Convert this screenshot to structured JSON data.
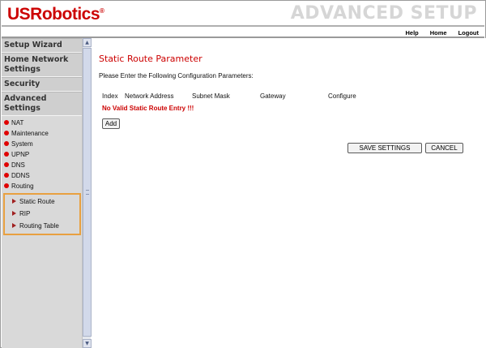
{
  "header": {
    "logo": "USRobotics",
    "logo_mark": "®",
    "title": "ADVANCED SETUP",
    "links": {
      "help": "Help",
      "home": "Home",
      "logout": "Logout"
    }
  },
  "sidebar": {
    "sections": [
      "Setup Wizard",
      "Home Network Settings",
      "Security",
      "Advanced Settings"
    ],
    "items": [
      "NAT",
      "Maintenance",
      "System",
      "UPNP",
      "DNS",
      "DDNS",
      "Routing"
    ],
    "routing_items": [
      "Static Route",
      "RIP",
      "Routing Table"
    ]
  },
  "main": {
    "title": "Static Route Parameter",
    "intro": "Please Enter the Following Configuration Parameters:",
    "columns": [
      "Index",
      "Network Address",
      "Subnet Mask",
      "Gateway",
      "Configure"
    ],
    "empty_message": "No Valid Static Route Entry !!!",
    "add_label": "Add",
    "save_label": "SAVE SETTINGS",
    "cancel_label": "CANCEL"
  },
  "icons": {
    "bullet": "red-dot-icon",
    "sub_bullet": "red-triangle-icon",
    "scroll_up": "chevron-up-icon",
    "scroll_down": "chevron-down-icon"
  },
  "colors": {
    "brand_red": "#cc0000",
    "highlight_border": "#e8a040",
    "sidebar_bg": "#d9d9d9"
  }
}
